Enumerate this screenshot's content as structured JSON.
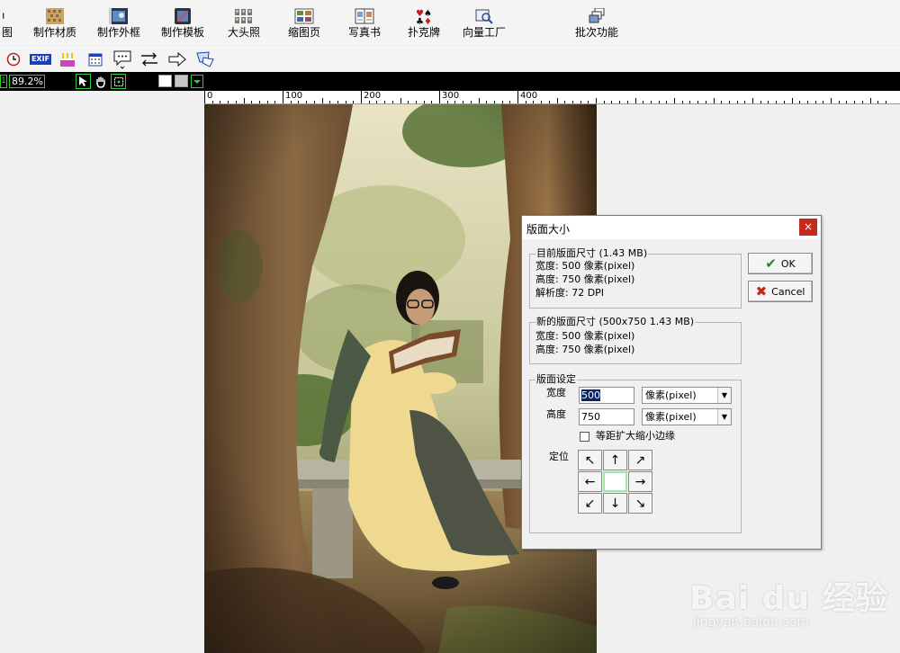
{
  "toolbar_top": {
    "items": [
      {
        "label": "图",
        "icon": "partial-icon"
      },
      {
        "label": "制作材质",
        "icon": "texture-icon"
      },
      {
        "label": "制作外框",
        "icon": "frame-icon"
      },
      {
        "label": "制作模板",
        "icon": "template-icon"
      },
      {
        "label": "大头照",
        "icon": "portrait-icon"
      },
      {
        "label": "缩图页",
        "icon": "thumbnail-icon"
      },
      {
        "label": "写真书",
        "icon": "photobook-icon"
      },
      {
        "label": "扑克牌",
        "icon": "poker-icon"
      },
      {
        "label": "向量工厂",
        "icon": "vector-icon"
      },
      {
        "label": "批次功能",
        "icon": "batch-icon"
      }
    ]
  },
  "toolbar_small": {
    "icons": [
      "clock-icon",
      "exif-icon",
      "cake-icon",
      "calendar-icon",
      "speech-bubble-icon",
      "swap-arrows-icon",
      "arrow-right-icon",
      "stamp-icon"
    ],
    "exif_label": "EXIF"
  },
  "status_strip": {
    "zoom": "89.2%",
    "left_marker": "1"
  },
  "ruler": {
    "labels": [
      "0",
      "100",
      "200",
      "300",
      "400"
    ]
  },
  "dialog": {
    "title": "版面大小",
    "close_symbol": "×",
    "current": {
      "legend": "目前版面尺寸 (1.43 MB)",
      "width": "宽度: 500 像素(pixel)",
      "height": "高度: 750 像素(pixel)",
      "resolution": "解析度: 72 DPI"
    },
    "new": {
      "legend": "新的版面尺寸 (500x750 1.43 MB)",
      "width": "宽度: 500 像素(pixel)",
      "height": "高度: 750 像素(pixel)"
    },
    "settings": {
      "legend": "版面设定",
      "width_label": "宽度",
      "width_value": "500",
      "width_unit": "像素(pixel)",
      "height_label": "高度",
      "height_value": "750",
      "height_unit": "像素(pixel)",
      "equal_margin_label": "等距扩大缩小边缘",
      "position_label": "定位"
    },
    "ok_label": "OK",
    "cancel_label": "Cancel"
  },
  "watermark": {
    "brand": "Bai du 经验",
    "sub": "jingyan.baidu.com"
  },
  "colors": {
    "accent_green": "#2fd12f",
    "close_red": "#c42b1c",
    "ok_check": "#1f8a1f",
    "cancel_x": "#c0281c"
  }
}
